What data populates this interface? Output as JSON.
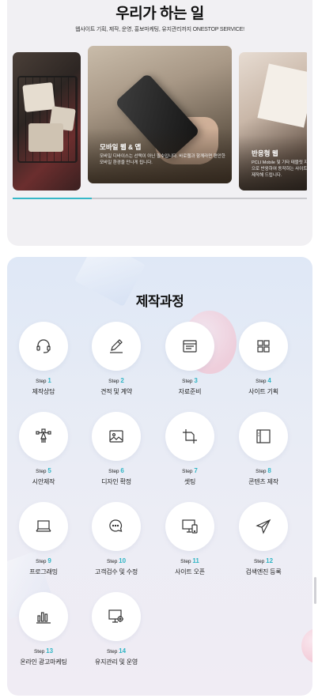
{
  "services": {
    "title": "우리가 하는 일",
    "subtitle": "웹사이트 기획, 제작, 운영, 홍보마케팅, 유지관리까지 ONESTOP SERVICE!",
    "slides": [
      {
        "title": "",
        "desc": ""
      },
      {
        "title": "모바일 웹 & 앱",
        "desc": "모바일 디바이스는 선택이 아닌 필수입니다. 바로웹과 함께라면 편안한 모바일 환경을 만나게 됩니다."
      },
      {
        "title": "반응형 웹",
        "desc": "PCLI Mobile 및 기타 태블릿 자동으로 반응하여 동작하는 사이트로 제작해 드립니다."
      }
    ],
    "progress_fraction": 0.27
  },
  "process": {
    "title": "제작과정",
    "step_prefix": "Step",
    "steps": [
      {
        "num": "1",
        "name": "제작상담",
        "icon": "headset-icon"
      },
      {
        "num": "2",
        "name": "견적 및 계약",
        "icon": "pen-icon"
      },
      {
        "num": "3",
        "name": "자료준비",
        "icon": "browser-window-icon"
      },
      {
        "num": "4",
        "name": "사이트 기획",
        "icon": "grid-icon"
      },
      {
        "num": "5",
        "name": "시안제작",
        "icon": "vector-pen-icon"
      },
      {
        "num": "6",
        "name": "디자인 확정",
        "icon": "image-icon"
      },
      {
        "num": "7",
        "name": "셋팅",
        "icon": "crop-icon"
      },
      {
        "num": "8",
        "name": "콘텐츠 제작",
        "icon": "layout-sidebar-icon"
      },
      {
        "num": "9",
        "name": "프로그래밍",
        "icon": "laptop-icon"
      },
      {
        "num": "10",
        "name": "고객검수 및 수정",
        "icon": "chat-bubbles-icon"
      },
      {
        "num": "11",
        "name": "사이트 오픈",
        "icon": "devices-icon"
      },
      {
        "num": "12",
        "name": "검색엔진 등록",
        "icon": "paper-plane-icon"
      },
      {
        "num": "13",
        "name": "온라인 광고마케팅",
        "icon": "bar-chart-icon"
      },
      {
        "num": "14",
        "name": "유지관리 및 운영",
        "icon": "monitor-gear-icon"
      }
    ]
  },
  "colors": {
    "accent": "#2fb4c4",
    "progress": "#36b8c8"
  }
}
